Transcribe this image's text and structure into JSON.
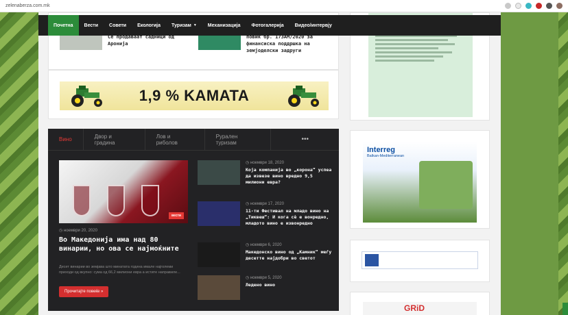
{
  "browser": {
    "url": "zelenaberza.com.mk"
  },
  "nav": {
    "items": [
      {
        "label": "Почетна",
        "active": true
      },
      {
        "label": "Вести"
      },
      {
        "label": "Совети"
      },
      {
        "label": "Екологија"
      },
      {
        "label": "Туризам",
        "has_dropdown": true
      },
      {
        "label": "Механизација"
      },
      {
        "label": "Фотогалерија"
      },
      {
        "label": "Видео/интервју"
      }
    ]
  },
  "top_articles": [
    {
      "title": "Се продаваат садници од Аронија"
    },
    {
      "title": "повик бр. 173АМ/2020 за финансиска поддршка на земјоделски задруги"
    }
  ],
  "banner": {
    "text": "1,9 % KAMATA"
  },
  "category_block": {
    "tabs": [
      "Вино",
      "Двор и градина",
      "Лов и риболов",
      "Рурален туризам"
    ],
    "more_label": "•••",
    "feature": {
      "badge": "вести",
      "date": "ноември 20, 2020",
      "title": "Во Македонија има над 80 винарии, но ова се најмоќните",
      "excerpt": "Десет винарии во земјава што минатата година имале најголеми приходи од вкупно: сума од 66,2 милиони евра а истите направиле...",
      "read_more": "Прочитајте повеќе »"
    },
    "list": [
      {
        "date": "ноември 18, 2020",
        "title": "Која компанија во „корона“ успеа да извезе вино вредно 9,5 милиони евра?"
      },
      {
        "date": "ноември 17, 2020",
        "title": "11-ти Фестивал на младо вино на „Тиквеш“: И кога сè е вонредно, младото вино е извонредно"
      },
      {
        "date": "ноември 6, 2020",
        "title": "Македонско вино од „Камник“ меѓу десетте најдобри во светот"
      },
      {
        "date": "ноември 5, 2020",
        "title": "Ледено вино"
      }
    ]
  },
  "sidebar": {
    "interreg": {
      "title": "Interreg",
      "subtitle": "Balkan-Mediterranean"
    },
    "bottom": {
      "logo_text": "GRiD"
    }
  },
  "colors": {
    "nav_active": "#2c8c3a",
    "accent_red": "#e53935",
    "dark_block": "#222224"
  }
}
